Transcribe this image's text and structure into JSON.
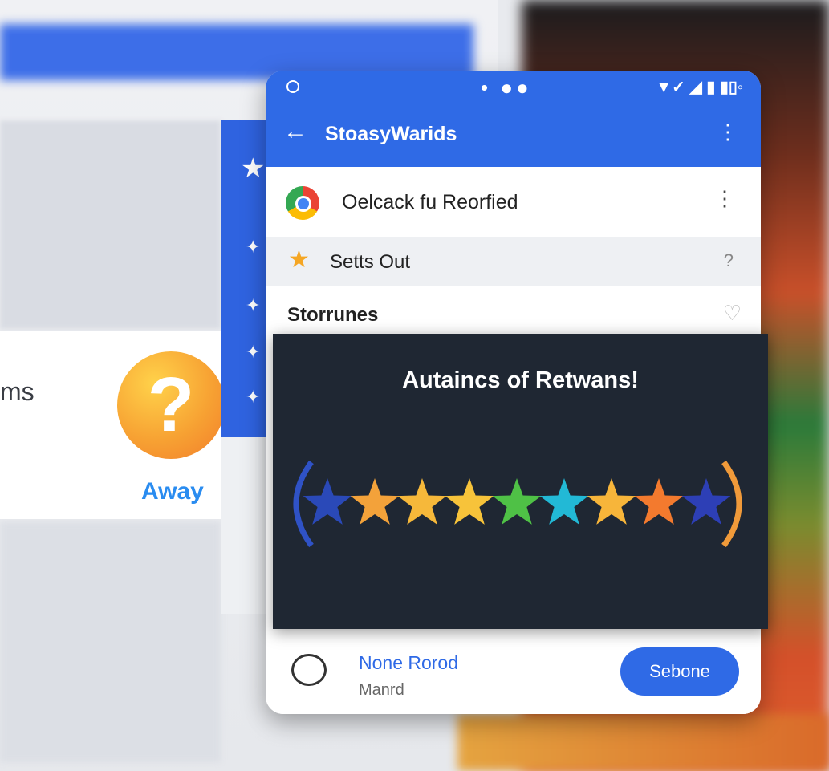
{
  "background": {
    "card_text": "ms",
    "away_label": "Away"
  },
  "appbar": {
    "title": "StoasyWarids"
  },
  "list": {
    "row1": "Oelcack fu Reorfied",
    "row2": "Setts Out",
    "row3": "Storrunes"
  },
  "panel": {
    "title": "Autaincs of Retwans!",
    "rating": {
      "value": 9,
      "max": 9
    },
    "star_colors": [
      "#2a49b8",
      "#f3a23a",
      "#f6b83a",
      "#f7c33a",
      "#4fc146",
      "#22b9d6",
      "#f7b53a",
      "#f37a2e",
      "#2d3fb6"
    ]
  },
  "footer": {
    "primary": "None Rorod",
    "secondary": "Manrd",
    "button": "Sebone"
  },
  "colors": {
    "accent": "#2f6ae6",
    "panel": "#1f2733"
  }
}
